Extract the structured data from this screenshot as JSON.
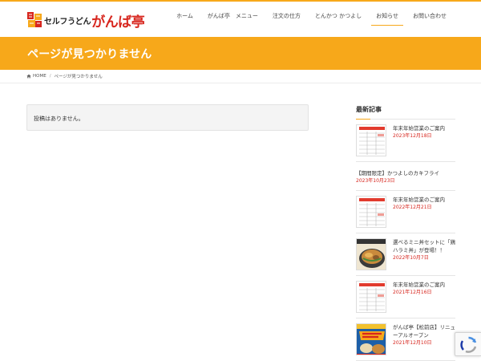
{
  "header": {
    "logo": {
      "sub_text": "セルフうどん",
      "main_text": "がんば亭"
    },
    "nav": [
      {
        "label": "ホーム"
      },
      {
        "label": "がんば亭　メニュー"
      },
      {
        "label": "注文の仕方"
      },
      {
        "label": "とんかつ かつよし"
      },
      {
        "label": "お知らせ",
        "active": true
      },
      {
        "label": "お問い合わせ"
      }
    ]
  },
  "banner": {
    "title": "ページが見つかりません"
  },
  "breadcrumb": {
    "home": "HOME",
    "current": "ページが見つかりません"
  },
  "main": {
    "message": "投稿はありません。"
  },
  "sidebar": {
    "title": "最新記事",
    "posts": [
      {
        "title": "年末年始営業のご案内",
        "date": "2023年12月18日",
        "thumb": "schedule"
      },
      {
        "title": "【期間限定】かつよしのカキフライ",
        "date": "2023年10月23日",
        "thumb": ""
      },
      {
        "title": "年末年始営業のご案内",
        "date": "2022年12月21日",
        "thumb": "schedule"
      },
      {
        "title": "選べるミニ丼セットに「鶏ハラミ丼」が登場！！",
        "date": "2022年10月7日",
        "thumb": "food"
      },
      {
        "title": "年末年始営業のご案内",
        "date": "2021年12月16日",
        "thumb": "schedule"
      },
      {
        "title": "がんば亭【松前店】リニューアルオープン",
        "date": "2021年12月10日",
        "thumb": "open"
      }
    ]
  },
  "colors": {
    "accent": "#f7a81a",
    "brand_red": "#d7261e",
    "date_red": "#d7261e"
  },
  "icons": {
    "home": "home-icon",
    "captcha": "recaptcha-icon"
  }
}
